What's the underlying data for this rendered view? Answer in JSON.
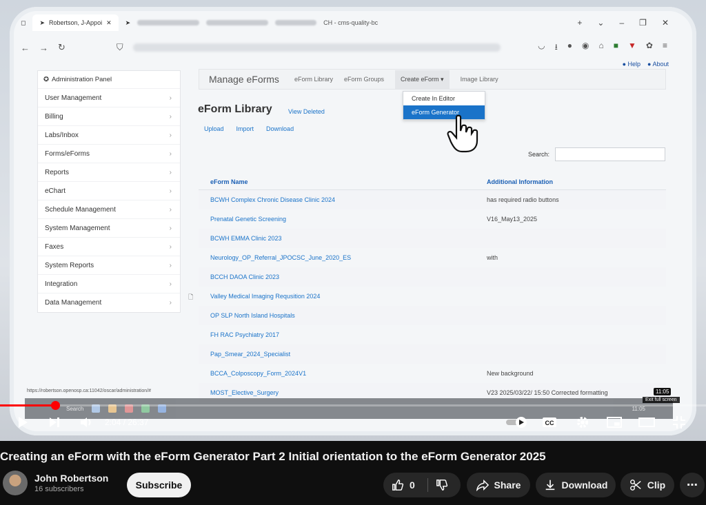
{
  "browser": {
    "tab_title": "Robertson, J-Appoi",
    "tab_extra": "CH - cms-quality-bc",
    "status_url": "https://robertson.openosp.ca:11042/oscar/administration/#"
  },
  "app": {
    "brand": "Manage eForms",
    "help_label": "Help",
    "about_label": "About",
    "sidebar_title": "Administration Panel",
    "sidebar_items": [
      {
        "label": "User Management"
      },
      {
        "label": "Billing"
      },
      {
        "label": "Labs/Inbox"
      },
      {
        "label": "Forms/eForms"
      },
      {
        "label": "Reports"
      },
      {
        "label": "eChart"
      },
      {
        "label": "Schedule Management"
      },
      {
        "label": "System Management"
      },
      {
        "label": "Faxes"
      },
      {
        "label": "System Reports"
      },
      {
        "label": "Integration"
      },
      {
        "label": "Data Management"
      }
    ],
    "nav": {
      "library": "eForm Library",
      "groups": "eForm Groups",
      "create": "Create eForm",
      "images": "Image Library"
    },
    "dropdown": {
      "item1": "Create In Editor",
      "item2": "eForm Generator"
    },
    "library_title": "eForm Library",
    "view_deleted": "View Deleted",
    "actions": {
      "upload": "Upload",
      "import": "Import",
      "download": "Download"
    },
    "search_label": "Search:",
    "table": {
      "col_name": "eForm Name",
      "col_info": "Additional Information",
      "rows": [
        {
          "name": "BCWH Complex Chronic Disease Clinic 2024",
          "info": "has required radio buttons"
        },
        {
          "name": "Prenatal Genetic Screening",
          "info": "V16_May13_2025"
        },
        {
          "name": "BCWH EMMA Clinic 2023",
          "info": ""
        },
        {
          "name": "Neurology_OP_Referral_JPOCSC_June_2020_ES",
          "info": "with"
        },
        {
          "name": "BCCH DAOA Clinic 2023",
          "info": ""
        },
        {
          "name": "Valley Medical Imaging Requsition 2024",
          "info": ""
        },
        {
          "name": "OP SLP North Island Hospitals",
          "info": ""
        },
        {
          "name": "FH RAC Psychiatry 2017",
          "info": ""
        },
        {
          "name": "Pap_Smear_2024_Specialist",
          "info": ""
        },
        {
          "name": "BCCA_Colposcopy_Form_2024V1",
          "info": "New background"
        },
        {
          "name": "MOST_Elective_Surgery",
          "info": "V23 2025/03/22/ 15:50 Corrected formatting"
        }
      ]
    }
  },
  "taskbar": {
    "search": "Search",
    "clock": "11:05"
  },
  "player": {
    "time": "2:04 / 26:37",
    "progress": 0.078,
    "exit_tip": "Exit full screen",
    "timestamp": "11:05",
    "accent": "#ff0000"
  },
  "video": {
    "title": "Creating an eForm with the eForm Generator Part 2 Initial orientation to the eForm Generator 2025",
    "channel": "John Robertson",
    "subscribers": "16 subscribers",
    "subscribe_label": "Subscribe",
    "likes": "0",
    "share_label": "Share",
    "download_label": "Download",
    "clip_label": "Clip"
  }
}
